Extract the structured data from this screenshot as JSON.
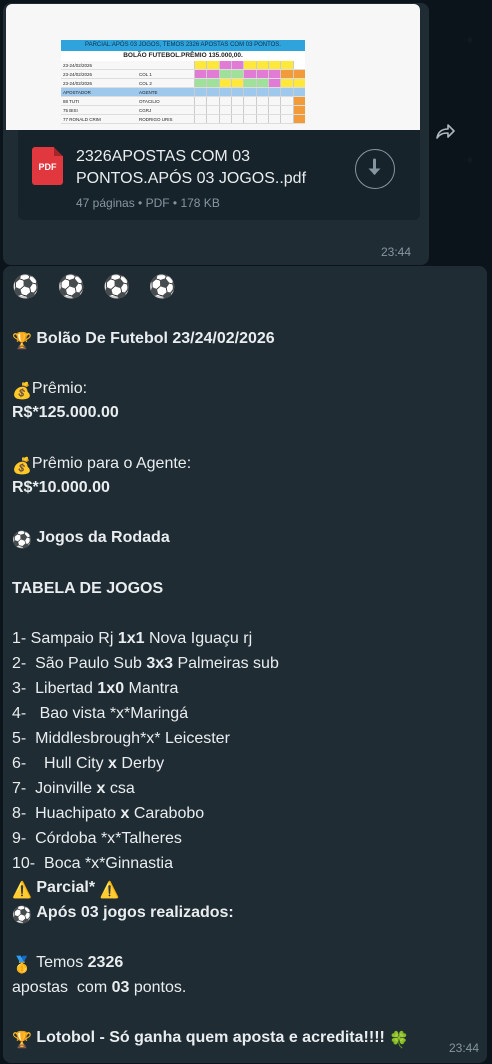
{
  "pdf_message": {
    "preview": {
      "header": "PARCIAL:APÓS 03 JOGOS, TEMOS 2326 APOSTAS COM 03 PONTOS.",
      "title": "BOLÃO FUTEBOL.PRÊMIO 135.000,00.",
      "rows": [
        {
          "a": "23-24/02/2026",
          "b": ""
        },
        {
          "a": "23-24/02/2026",
          "b": "COL 1"
        },
        {
          "a": "23-24/02/2026",
          "b": "COL 2"
        },
        {
          "a": "APOSTADOR",
          "b": "AGENTE"
        },
        {
          "a": "88     TUTI",
          "b": "OTACILIO"
        },
        {
          "a": "75     BISI",
          "b": "CGRJ"
        },
        {
          "a": "77     RONALD CRIM",
          "b": "RODRIGO URIS"
        }
      ]
    },
    "file_icon_label": "PDF",
    "file_name": "2326APOSTAS COM 03 PONTOS.APÓS 03 JOGOS..pdf",
    "file_meta": "47 páginas • PDF • 178 KB",
    "time": "23:44"
  },
  "text_message": {
    "emoji_row": "⚽ ⚽ ⚽ ⚽",
    "title": "Bolão De Futebol 23/24/02/2026",
    "prize_label": "Prêmio:",
    "prize_value": "R$*125.000.00",
    "agent_prize_label": "Prêmio para o Agente:",
    "agent_prize_value": "R$*10.000.00",
    "round_title": "Jogos da Rodada",
    "table_title": "TABELA DE JOGOS",
    "games": [
      {
        "num": "1- ",
        "home": "Sampaio Rj ",
        "score": "1x1",
        "away": " Nova Iguaçu rj"
      },
      {
        "num": "2-  ",
        "home": "São Paulo Sub ",
        "score": "3x3",
        "away": " Palmeiras sub"
      },
      {
        "num": "3-  ",
        "home": "Libertad ",
        "score": "1x0",
        "away": " Mantra"
      },
      {
        "num": "4-   ",
        "home": "Bao vista ",
        "score": "*x*",
        "away": "Maringá"
      },
      {
        "num": "5-  ",
        "home": "Middlesbrough",
        "score": "*x*",
        "away": " Leicester"
      },
      {
        "num": "6-    ",
        "home": "Hull City ",
        "score": "x",
        "away": " Derby"
      },
      {
        "num": "7-  ",
        "home": "Joinville ",
        "score": "x",
        "away": " csa"
      },
      {
        "num": "8-  ",
        "home": "Huachipato ",
        "score": "x",
        "away": " Carabobo"
      },
      {
        "num": "9-  ",
        "home": "Córdoba ",
        "score": "*x*",
        "away": "Talheres"
      },
      {
        "num": "10-  ",
        "home": "Boca ",
        "score": "*x*",
        "away": "Ginnastia"
      }
    ],
    "partial_title": "Parcial*",
    "after_games": "Após 03 jogos realizados:",
    "have_prefix": "Temos ",
    "have_count": "2326",
    "bets_prefix": "apostas  com ",
    "bets_points": "03",
    "bets_suffix": " pontos.",
    "footer": "Lotobol - Só ganha quem aposta e acredita!!!!",
    "time": "23:44"
  },
  "colors": {
    "background": "#0b141a",
    "bubble": "#1f2c33",
    "text": "#e9edef",
    "muted": "#8696a0",
    "pdf_red": "#e0383e"
  }
}
